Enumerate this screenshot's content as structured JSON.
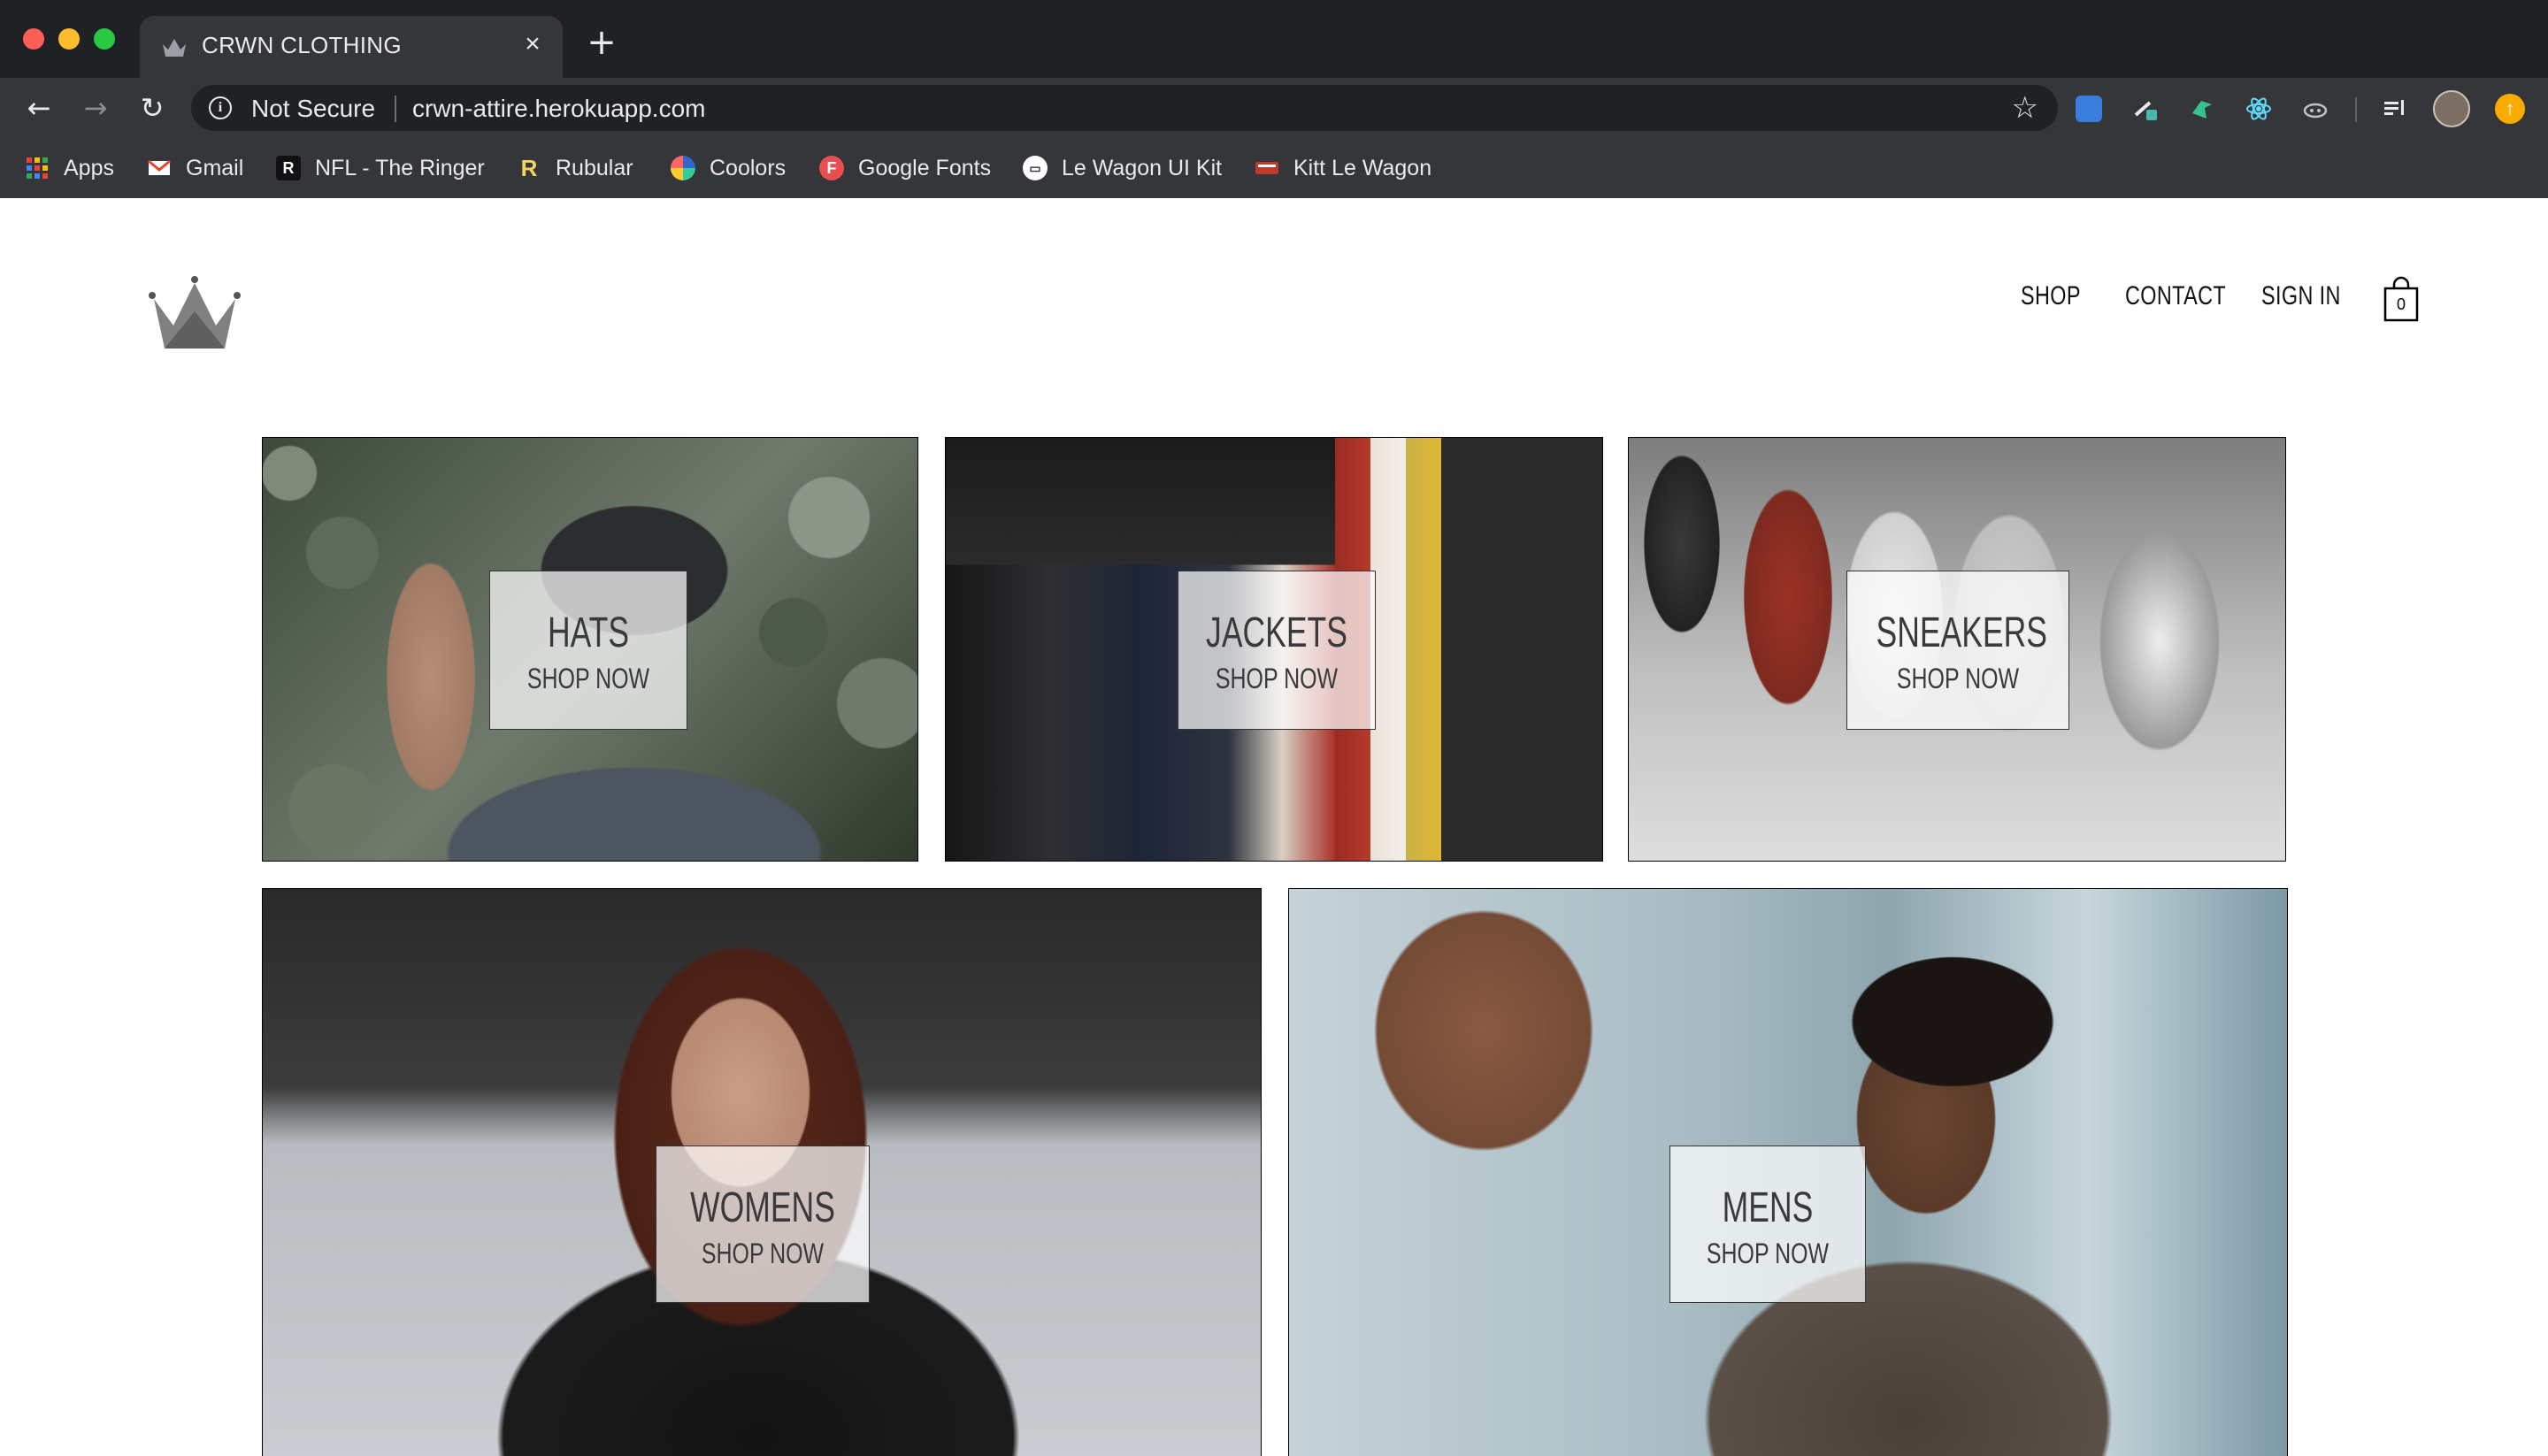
{
  "browser": {
    "tab_title": "CRWN CLOTHING",
    "tab_close": "×",
    "new_tab": "+",
    "security_label": "Not Secure",
    "url": "crwn-attire.herokuapp.com",
    "bookmarks": [
      {
        "label": "Apps",
        "icon": "apps-grid-icon"
      },
      {
        "label": "Gmail",
        "icon": "gmail-icon"
      },
      {
        "label": "NFL - The Ringer",
        "icon": "ringer-icon"
      },
      {
        "label": "Rubular",
        "icon": "rubular-icon"
      },
      {
        "label": "Coolors",
        "icon": "coolors-icon"
      },
      {
        "label": "Google Fonts",
        "icon": "google-fonts-icon"
      },
      {
        "label": "Le Wagon UI Kit",
        "icon": "le-wagon-icon"
      },
      {
        "label": "Kitt Le Wagon",
        "icon": "kitt-icon"
      }
    ]
  },
  "header": {
    "nav": {
      "shop": "SHOP",
      "contact": "CONTACT",
      "sign_in": "SIGN IN"
    },
    "cart_count": "0"
  },
  "directory": [
    {
      "title": "HATS",
      "subtitle": "SHOP NOW"
    },
    {
      "title": "JACKETS",
      "subtitle": "SHOP NOW"
    },
    {
      "title": "SNEAKERS",
      "subtitle": "SHOP NOW"
    },
    {
      "title": "WOMENS",
      "subtitle": "SHOP NOW"
    },
    {
      "title": "MENS",
      "subtitle": "SHOP NOW"
    }
  ],
  "colors": {
    "chrome_dark": "#202124",
    "chrome_toolbar": "#35363a",
    "label_text": "#3a3a3a"
  }
}
